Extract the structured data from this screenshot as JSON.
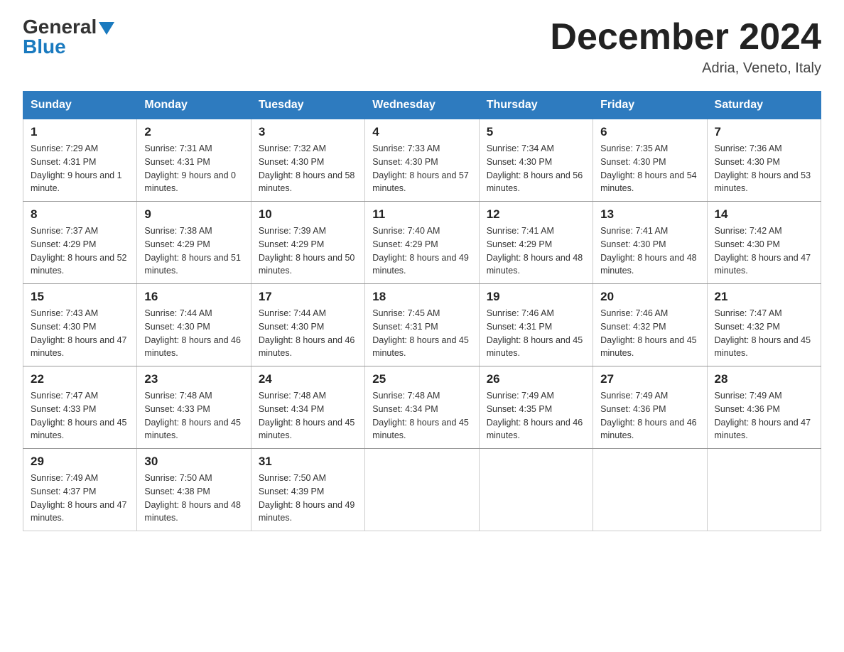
{
  "header": {
    "logo_line1": "General",
    "logo_line2": "Blue",
    "month": "December 2024",
    "location": "Adria, Veneto, Italy"
  },
  "days_of_week": [
    "Sunday",
    "Monday",
    "Tuesday",
    "Wednesday",
    "Thursday",
    "Friday",
    "Saturday"
  ],
  "weeks": [
    [
      {
        "day": "1",
        "sunrise": "Sunrise: 7:29 AM",
        "sunset": "Sunset: 4:31 PM",
        "daylight": "Daylight: 9 hours and 1 minute."
      },
      {
        "day": "2",
        "sunrise": "Sunrise: 7:31 AM",
        "sunset": "Sunset: 4:31 PM",
        "daylight": "Daylight: 9 hours and 0 minutes."
      },
      {
        "day": "3",
        "sunrise": "Sunrise: 7:32 AM",
        "sunset": "Sunset: 4:30 PM",
        "daylight": "Daylight: 8 hours and 58 minutes."
      },
      {
        "day": "4",
        "sunrise": "Sunrise: 7:33 AM",
        "sunset": "Sunset: 4:30 PM",
        "daylight": "Daylight: 8 hours and 57 minutes."
      },
      {
        "day": "5",
        "sunrise": "Sunrise: 7:34 AM",
        "sunset": "Sunset: 4:30 PM",
        "daylight": "Daylight: 8 hours and 56 minutes."
      },
      {
        "day": "6",
        "sunrise": "Sunrise: 7:35 AM",
        "sunset": "Sunset: 4:30 PM",
        "daylight": "Daylight: 8 hours and 54 minutes."
      },
      {
        "day": "7",
        "sunrise": "Sunrise: 7:36 AM",
        "sunset": "Sunset: 4:30 PM",
        "daylight": "Daylight: 8 hours and 53 minutes."
      }
    ],
    [
      {
        "day": "8",
        "sunrise": "Sunrise: 7:37 AM",
        "sunset": "Sunset: 4:29 PM",
        "daylight": "Daylight: 8 hours and 52 minutes."
      },
      {
        "day": "9",
        "sunrise": "Sunrise: 7:38 AM",
        "sunset": "Sunset: 4:29 PM",
        "daylight": "Daylight: 8 hours and 51 minutes."
      },
      {
        "day": "10",
        "sunrise": "Sunrise: 7:39 AM",
        "sunset": "Sunset: 4:29 PM",
        "daylight": "Daylight: 8 hours and 50 minutes."
      },
      {
        "day": "11",
        "sunrise": "Sunrise: 7:40 AM",
        "sunset": "Sunset: 4:29 PM",
        "daylight": "Daylight: 8 hours and 49 minutes."
      },
      {
        "day": "12",
        "sunrise": "Sunrise: 7:41 AM",
        "sunset": "Sunset: 4:29 PM",
        "daylight": "Daylight: 8 hours and 48 minutes."
      },
      {
        "day": "13",
        "sunrise": "Sunrise: 7:41 AM",
        "sunset": "Sunset: 4:30 PM",
        "daylight": "Daylight: 8 hours and 48 minutes."
      },
      {
        "day": "14",
        "sunrise": "Sunrise: 7:42 AM",
        "sunset": "Sunset: 4:30 PM",
        "daylight": "Daylight: 8 hours and 47 minutes."
      }
    ],
    [
      {
        "day": "15",
        "sunrise": "Sunrise: 7:43 AM",
        "sunset": "Sunset: 4:30 PM",
        "daylight": "Daylight: 8 hours and 47 minutes."
      },
      {
        "day": "16",
        "sunrise": "Sunrise: 7:44 AM",
        "sunset": "Sunset: 4:30 PM",
        "daylight": "Daylight: 8 hours and 46 minutes."
      },
      {
        "day": "17",
        "sunrise": "Sunrise: 7:44 AM",
        "sunset": "Sunset: 4:30 PM",
        "daylight": "Daylight: 8 hours and 46 minutes."
      },
      {
        "day": "18",
        "sunrise": "Sunrise: 7:45 AM",
        "sunset": "Sunset: 4:31 PM",
        "daylight": "Daylight: 8 hours and 45 minutes."
      },
      {
        "day": "19",
        "sunrise": "Sunrise: 7:46 AM",
        "sunset": "Sunset: 4:31 PM",
        "daylight": "Daylight: 8 hours and 45 minutes."
      },
      {
        "day": "20",
        "sunrise": "Sunrise: 7:46 AM",
        "sunset": "Sunset: 4:32 PM",
        "daylight": "Daylight: 8 hours and 45 minutes."
      },
      {
        "day": "21",
        "sunrise": "Sunrise: 7:47 AM",
        "sunset": "Sunset: 4:32 PM",
        "daylight": "Daylight: 8 hours and 45 minutes."
      }
    ],
    [
      {
        "day": "22",
        "sunrise": "Sunrise: 7:47 AM",
        "sunset": "Sunset: 4:33 PM",
        "daylight": "Daylight: 8 hours and 45 minutes."
      },
      {
        "day": "23",
        "sunrise": "Sunrise: 7:48 AM",
        "sunset": "Sunset: 4:33 PM",
        "daylight": "Daylight: 8 hours and 45 minutes."
      },
      {
        "day": "24",
        "sunrise": "Sunrise: 7:48 AM",
        "sunset": "Sunset: 4:34 PM",
        "daylight": "Daylight: 8 hours and 45 minutes."
      },
      {
        "day": "25",
        "sunrise": "Sunrise: 7:48 AM",
        "sunset": "Sunset: 4:34 PM",
        "daylight": "Daylight: 8 hours and 45 minutes."
      },
      {
        "day": "26",
        "sunrise": "Sunrise: 7:49 AM",
        "sunset": "Sunset: 4:35 PM",
        "daylight": "Daylight: 8 hours and 46 minutes."
      },
      {
        "day": "27",
        "sunrise": "Sunrise: 7:49 AM",
        "sunset": "Sunset: 4:36 PM",
        "daylight": "Daylight: 8 hours and 46 minutes."
      },
      {
        "day": "28",
        "sunrise": "Sunrise: 7:49 AM",
        "sunset": "Sunset: 4:36 PM",
        "daylight": "Daylight: 8 hours and 47 minutes."
      }
    ],
    [
      {
        "day": "29",
        "sunrise": "Sunrise: 7:49 AM",
        "sunset": "Sunset: 4:37 PM",
        "daylight": "Daylight: 8 hours and 47 minutes."
      },
      {
        "day": "30",
        "sunrise": "Sunrise: 7:50 AM",
        "sunset": "Sunset: 4:38 PM",
        "daylight": "Daylight: 8 hours and 48 minutes."
      },
      {
        "day": "31",
        "sunrise": "Sunrise: 7:50 AM",
        "sunset": "Sunset: 4:39 PM",
        "daylight": "Daylight: 8 hours and 49 minutes."
      },
      null,
      null,
      null,
      null
    ]
  ]
}
